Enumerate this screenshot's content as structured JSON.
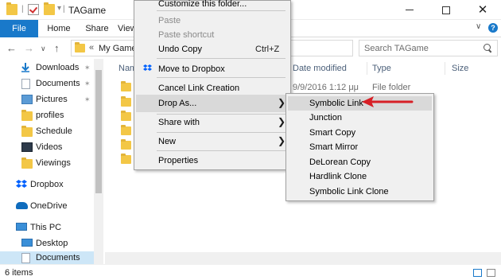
{
  "window": {
    "title": "TAGame",
    "title_separator": "|",
    "qa_dropdown": "▾",
    "minimize_label": "",
    "close_glyph": "✕"
  },
  "ribbon": {
    "tabs": [
      "File",
      "Home",
      "Share",
      "View"
    ],
    "help_glyph": "?",
    "collapse_glyph": "∨"
  },
  "address": {
    "back_glyph": "←",
    "forward_glyph": "→",
    "recent_glyph": "∨",
    "up_glyph": "↑",
    "chevron": "«",
    "path": "My Games",
    "search_placeholder": "Search TAGame"
  },
  "nav": {
    "items": [
      {
        "label": "Downloads",
        "icon": "download-icon",
        "pinned": true
      },
      {
        "label": "Documents",
        "icon": "documents-icon",
        "pinned": true
      },
      {
        "label": "Pictures",
        "icon": "pictures-icon",
        "pinned": true
      },
      {
        "label": "profiles",
        "icon": "folder-icon",
        "pinned": false
      },
      {
        "label": "Schedule",
        "icon": "folder-icon",
        "pinned": false
      },
      {
        "label": "Videos",
        "icon": "videos-icon",
        "pinned": false
      },
      {
        "label": "Viewings",
        "icon": "folder-icon",
        "pinned": false
      },
      {
        "label": "Dropbox",
        "icon": "dropbox-icon",
        "pinned": false
      },
      {
        "label": "OneDrive",
        "icon": "onedrive-icon",
        "pinned": false
      },
      {
        "label": "This PC",
        "icon": "computer-icon",
        "pinned": false
      },
      {
        "label": "Desktop",
        "icon": "desktop-icon",
        "pinned": false
      },
      {
        "label": "Documents",
        "icon": "documents-icon",
        "pinned": false
      }
    ],
    "pin_glyph": "✶"
  },
  "content": {
    "columns": [
      "Name",
      "Date modified",
      "Type",
      "Size"
    ],
    "sort_glyph": "∧",
    "first_row": {
      "date": "9/9/2016 1:12 μμ",
      "type": "File folder"
    }
  },
  "context_menu": {
    "items": [
      {
        "label": "Customize this folder...",
        "disabled": false
      },
      {
        "label": "Paste",
        "disabled": true
      },
      {
        "label": "Paste shortcut",
        "disabled": true
      },
      {
        "label": "Undo Copy",
        "shortcut": "Ctrl+Z",
        "disabled": false
      },
      {
        "label": "Move to Dropbox",
        "disabled": false,
        "icon": "dropbox-icon"
      },
      {
        "label": "Cancel Link Creation",
        "disabled": false
      },
      {
        "label": "Drop As...",
        "disabled": false,
        "submenu": true
      },
      {
        "label": "Share with",
        "disabled": false,
        "submenu": true
      },
      {
        "label": "New",
        "disabled": false,
        "submenu": true
      },
      {
        "label": "Properties",
        "disabled": false
      }
    ],
    "submenu_arrow": "❯"
  },
  "submenu": {
    "items": [
      "Symbolic Link",
      "Junction",
      "Smart Copy",
      "Smart Mirror",
      "DeLorean Copy",
      "Hardlink Clone",
      "Symbolic Link Clone"
    ]
  },
  "status": {
    "item_count": "6 items"
  },
  "colors": {
    "accent": "#1979ca",
    "annotation_arrow": "#d71f26",
    "folder": "#f3c746"
  }
}
